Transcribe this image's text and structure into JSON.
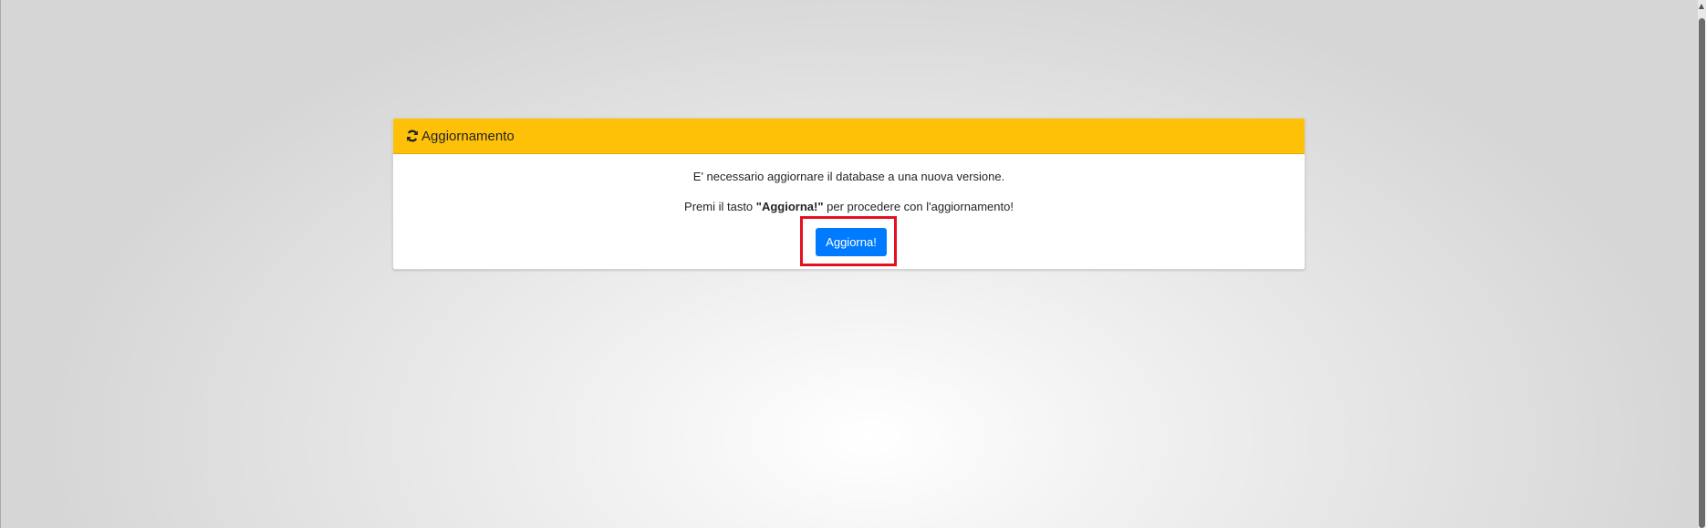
{
  "panel": {
    "title": "Aggiornamento",
    "icon": "refresh-icon",
    "header_color": "#ffc107"
  },
  "message": {
    "line1": "E' necessario aggiornare il database a una nuova versione.",
    "line2_prefix": "Premi il tasto ",
    "line2_bold": "\"Aggiorna!\"",
    "line2_suffix": " per procedere con l'aggiornamento!"
  },
  "update_button": {
    "label": "Aggiorna!",
    "color": "#007bff",
    "highlight_color": "#e3111f"
  }
}
